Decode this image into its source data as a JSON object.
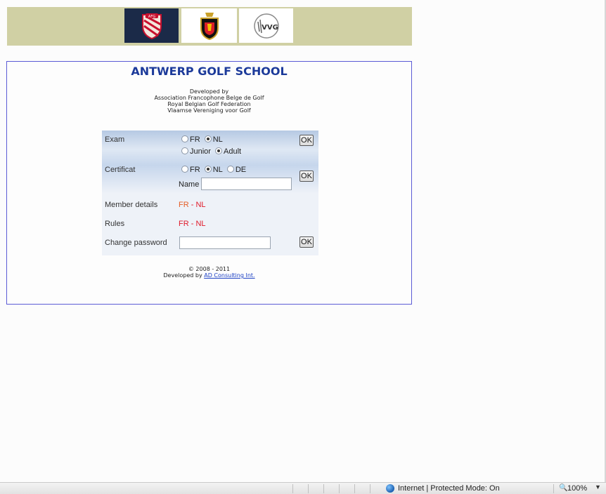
{
  "header": {
    "logos": [
      {
        "name": "AFG shield logo",
        "text": "AFG"
      },
      {
        "name": "Royal Belgian Golf Federation crest"
      },
      {
        "name": "VVG logo",
        "text": "VVG"
      }
    ]
  },
  "panel": {
    "title": "ANTWERP GOLF SCHOOL",
    "developed_by_lines": [
      "Developed by",
      "Association Francophone Belge de Golf",
      "Royal Belgian Golf Federation",
      "Vlaamse Vereniging voor Golf"
    ],
    "form": {
      "exam": {
        "label": "Exam",
        "lang_options": [
          "FR",
          "NL"
        ],
        "lang_selected": "NL",
        "level_options": [
          "Junior",
          "Adult"
        ],
        "level_selected": "Adult",
        "ok_label": "OK"
      },
      "certificat": {
        "label": "Certificat",
        "lang_options": [
          "FR",
          "NL",
          "DE"
        ],
        "lang_selected": "NL",
        "name_label": "Name",
        "name_value": "",
        "ok_label": "OK"
      },
      "member_details": {
        "label": "Member details",
        "fr": "FR",
        "sep": " - ",
        "nl": "NL"
      },
      "rules": {
        "label": "Rules",
        "fr": "FR",
        "sep": " - ",
        "nl": "NL"
      },
      "change_password": {
        "label": "Change password",
        "value": "",
        "ok_label": "OK"
      }
    },
    "footer": {
      "copyright": "© 2008 - 2011",
      "developed_prefix": "Developed by ",
      "developer_link": "AD Consulting Int."
    }
  },
  "statusbar": {
    "zone": "Internet | Protected Mode: On",
    "zoom": "100%"
  },
  "colors": {
    "banner": "#d0d0a4",
    "panel_border": "#5b5bd6",
    "title": "#1c3a9a",
    "fr_link": "#e55c24",
    "nl_link": "#e01a2a"
  }
}
